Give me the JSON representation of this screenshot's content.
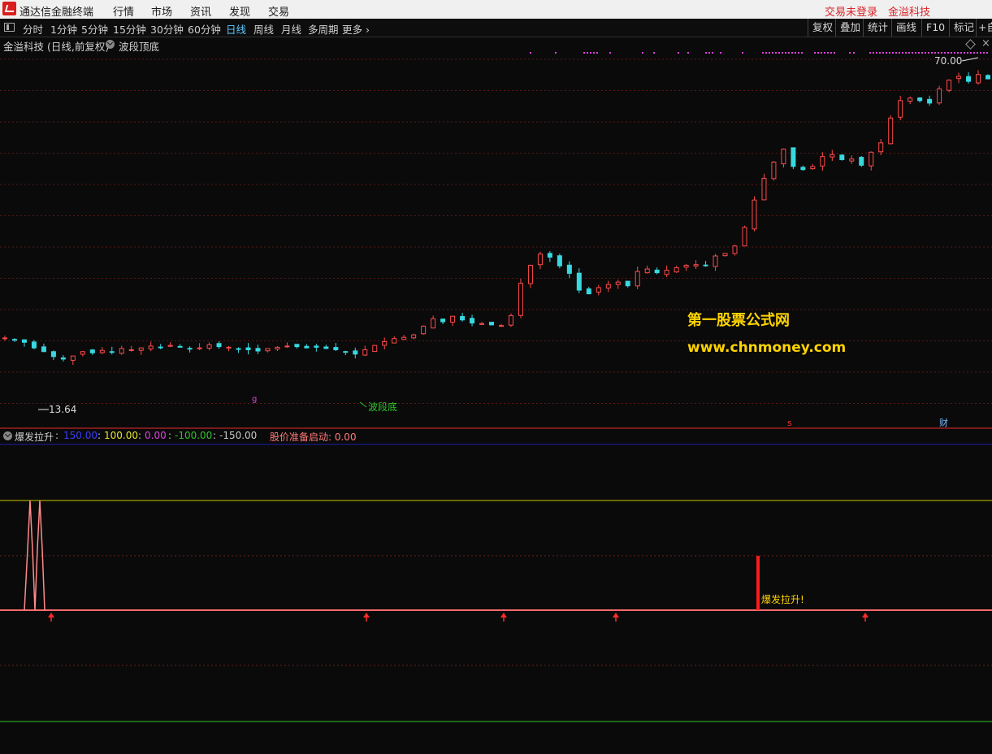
{
  "titlebar": {
    "app_title": "通达信金融终端",
    "menus": [
      "行情",
      "市场",
      "资讯",
      "发现",
      "交易"
    ],
    "login_status": "交易未登录",
    "account_name": "金溢科技"
  },
  "toolbar": {
    "periods": [
      "分时",
      "1分钟",
      "5分钟",
      "15分钟",
      "30分钟",
      "60分钟",
      "日线",
      "周线",
      "月线",
      "多周期",
      "更多 ›"
    ],
    "active_period": "日线",
    "right_buttons": [
      "复权",
      "叠加",
      "统计",
      "画线",
      "F10",
      "标记",
      "+自"
    ]
  },
  "stock_info": {
    "name": "金溢科技 (日线,前复权)",
    "indicator": "波段顶底"
  },
  "main_chart": {
    "high_label": "70.00",
    "low_label": "13.64",
    "bottom_label": "波段底",
    "marker_s": "s",
    "marker_cai": "财",
    "marker_g": "g",
    "watermark_line1": "第一股票公式网",
    "watermark_line2": "www.chnmoney.com"
  },
  "sub_indicator": {
    "name": "爆发拉升",
    "values": [
      {
        "text": "150.00",
        "color": "#3b3bff"
      },
      {
        "text": "100.00",
        "color": "#e6e62a"
      },
      {
        "text": "0.00",
        "color": "#e040e0"
      },
      {
        "text": "-100.00",
        "color": "#2ec42e"
      },
      {
        "text": "-150.00",
        "color": "#c8c8c8"
      }
    ],
    "extra_label": "股价准备启动: 0.00",
    "signal_text": "爆发拉升!"
  },
  "chart_data": {
    "type": "candlestick",
    "title": "金溢科技 (日线,前复权)",
    "price_high": 70.0,
    "price_low": 13.64,
    "approx_closes": [
      26.5,
      26.2,
      25.8,
      24.9,
      24.3,
      23.5,
      23.1,
      23.6,
      24.3,
      24.1,
      24.5,
      24.2,
      24.8,
      24.6,
      24.9,
      25.2,
      25.0,
      25.3,
      25.1,
      24.7,
      24.9,
      25.4,
      25.1,
      25.0,
      24.7,
      24.6,
      24.4,
      24.8,
      25.0,
      25.2,
      25.1,
      24.9,
      25.0,
      24.8,
      24.6,
      24.3,
      23.9,
      24.6,
      25.3,
      25.9,
      26.4,
      26.6,
      27.0,
      28.4,
      29.6,
      29.1,
      30.0,
      29.4,
      28.9,
      28.8,
      28.6,
      28.5,
      30.1,
      35.3,
      38.2,
      40.0,
      39.5,
      38.1,
      36.9,
      34.2,
      33.6,
      34.6,
      35.1,
      35.5,
      34.9,
      37.2,
      37.6,
      37.0,
      37.4,
      37.8,
      38.2,
      38.3,
      38.1,
      39.7,
      40.1,
      41.3,
      44.3,
      48.7,
      52.2,
      54.8,
      56.9,
      54.1,
      53.6,
      54.1,
      55.7,
      56.0,
      55.2,
      55.3,
      54.3,
      56.4,
      57.9,
      61.9,
      64.7,
      65.1,
      64.7,
      64.3,
      66.6,
      68.0,
      68.6,
      67.8,
      68.9,
      68.2
    ],
    "sub_lines": {
      "upper_150": 150,
      "upper_100": 100,
      "zero": 0,
      "lower_neg100": -100,
      "lower_neg150": -150
    },
    "signal_bar": {
      "name": "爆发拉升!",
      "value": 100
    }
  }
}
